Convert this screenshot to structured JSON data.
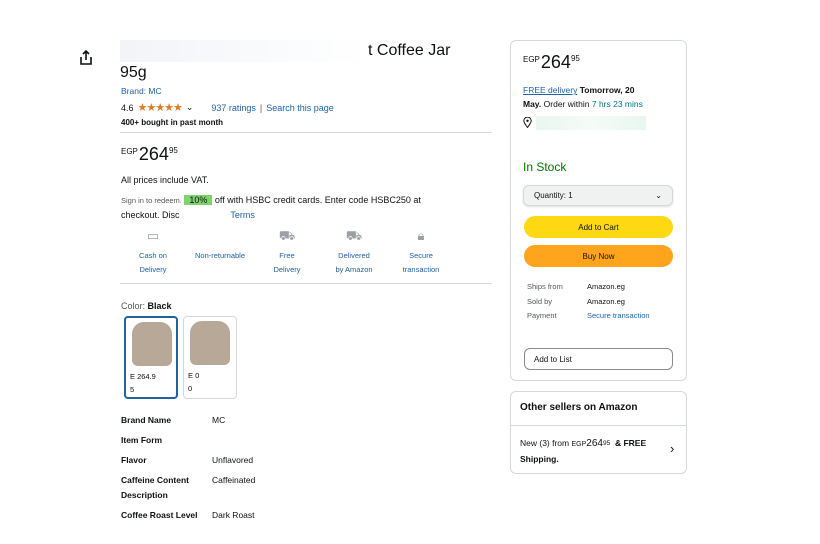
{
  "product": {
    "title_visible": "t Coffee Jar",
    "title_line2": "95g",
    "brand_label": "Brand: MC",
    "rating": "4.6",
    "stars": "★★★★★",
    "ratings_count": "937 ratings",
    "separator": "|",
    "search_page": "Search this page",
    "bought": "400+ bought in past month"
  },
  "price": {
    "currency": "EGP",
    "whole": "264",
    "fraction": "95"
  },
  "vat_note": "All prices include VAT.",
  "promo": {
    "sign_in": "Sign in to redeem.",
    "percent": "10%",
    "text": "off with HSBC credit cards. Enter code HSBC250 at",
    "line2": "checkout. Disc",
    "terms": "Terms"
  },
  "features": [
    {
      "icon": "cash-icon",
      "line1": "Cash on",
      "line2": "Delivery"
    },
    {
      "icon": "non-returnable-icon",
      "line1": "Non-returnable",
      "line2": ""
    },
    {
      "icon": "truck-icon",
      "line1": "Free",
      "line2": "Delivery"
    },
    {
      "icon": "van-icon",
      "line1": "Delivered",
      "line2": "by Amazon"
    },
    {
      "icon": "lock-icon",
      "line1": "Secure",
      "line2": "transaction"
    }
  ],
  "color": {
    "label": "Color:",
    "value": "Black",
    "swatches": [
      {
        "price_line1": "E    264.9",
        "price_line2": "5"
      },
      {
        "price_line1": "E         0",
        "price_line2": "0"
      }
    ]
  },
  "specs": [
    {
      "key": "Brand Name",
      "value": "MC"
    },
    {
      "key": "Item Form",
      "value": ""
    },
    {
      "key": "Flavor",
      "value": "Unflavored"
    },
    {
      "key": "Caffeine Content Description",
      "value": "Caffeinated"
    },
    {
      "key": "Coffee Roast Level",
      "value": "Dark Roast"
    }
  ],
  "buybox": {
    "currency": "EGP",
    "whole": "264",
    "fraction": "95",
    "free_delivery": "FREE delivery",
    "delivery_day": "Tomorrow, 20",
    "delivery_day2": "May.",
    "order_within": "Order within",
    "countdown": "7 hrs 23 mins",
    "in_stock": "In Stock",
    "quantity_label": "Quantity:",
    "quantity_value": "1",
    "add_to_cart": "Add to Cart",
    "buy_now": "Buy Now",
    "ships_from_k": "Ships from",
    "ships_from_v": "Amazon.eg",
    "sold_by_k": "Sold by",
    "sold_by_v": "Amazon.eg",
    "payment_k": "Payment",
    "payment_v": "Secure transaction",
    "add_to_list": "Add to List"
  },
  "other_sellers": {
    "heading": "Other sellers on Amazon",
    "new_from": "New (3) from",
    "currency": "EGP",
    "whole": "264",
    "fraction": "95",
    "free": "& FREE",
    "shipping": "Shipping."
  },
  "colors": {
    "link": "#2162a1",
    "cart_yellow": "#ffd814",
    "buy_orange": "#ffa41c",
    "stock_green": "#007600",
    "promo_green": "#7ed36f",
    "star_orange": "#de7921"
  }
}
